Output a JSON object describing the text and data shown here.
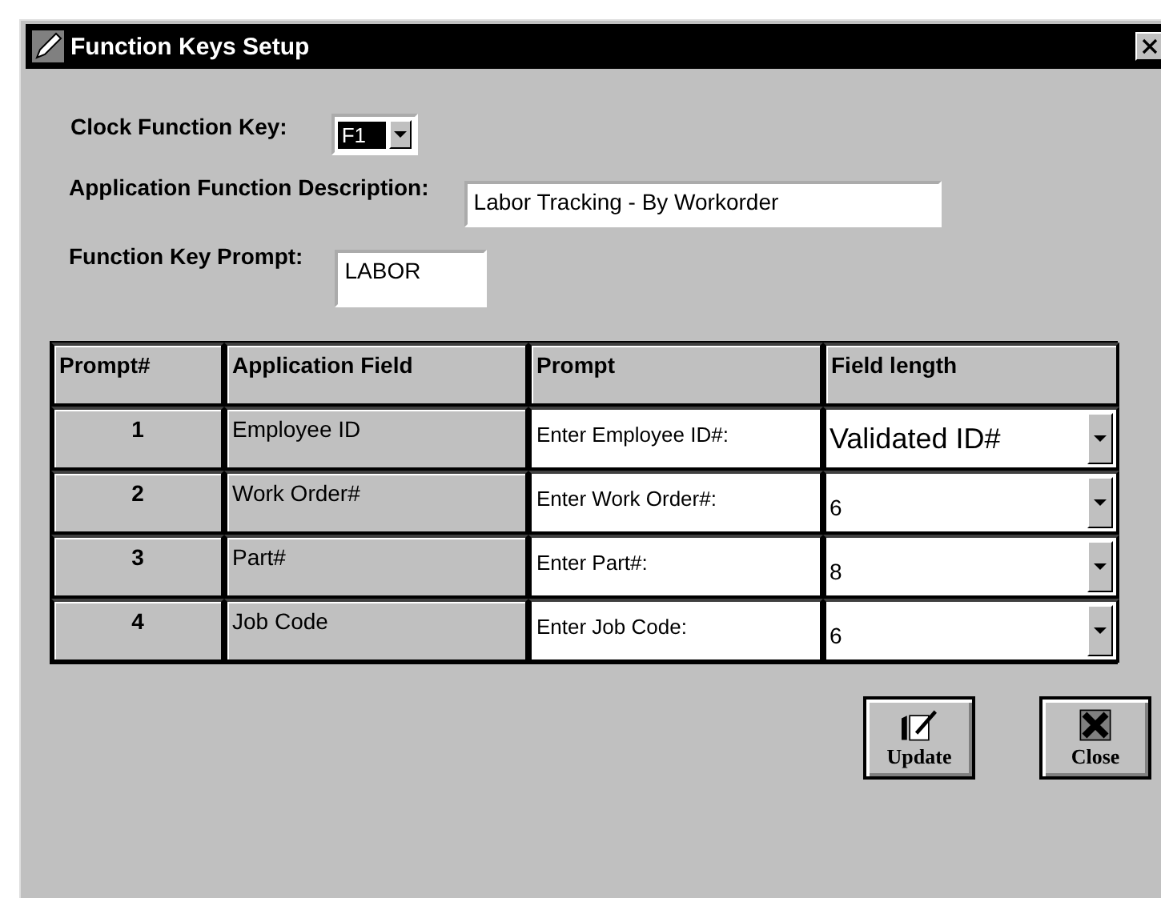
{
  "window": {
    "title": "Function Keys Setup"
  },
  "clock_function_key": {
    "label": "Clock Function Key:",
    "value": "F1"
  },
  "application_function_description": {
    "label": "Application Function Description:",
    "value": "Labor Tracking - By Workorder"
  },
  "function_key_prompt": {
    "label": "Function Key Prompt:",
    "value": "LABOR"
  },
  "table": {
    "columns": [
      "Prompt#",
      "Application Field",
      "Prompt",
      "Field length"
    ],
    "rows": [
      {
        "number": "1",
        "field": "Employee ID",
        "prompt": "Enter Employee ID#:",
        "length": "Validated ID#"
      },
      {
        "number": "2",
        "field": "Work Order#",
        "prompt": "Enter Work Order#:",
        "length": "6"
      },
      {
        "number": "3",
        "field": "Part#",
        "prompt": "Enter Part#:",
        "length": "8"
      },
      {
        "number": "4",
        "field": "Job Code",
        "prompt": "Enter Job Code:",
        "length": "6"
      }
    ]
  },
  "buttons": [
    {
      "label": "Update",
      "kind": "update"
    },
    {
      "label": "Close",
      "kind": "close"
    }
  ]
}
